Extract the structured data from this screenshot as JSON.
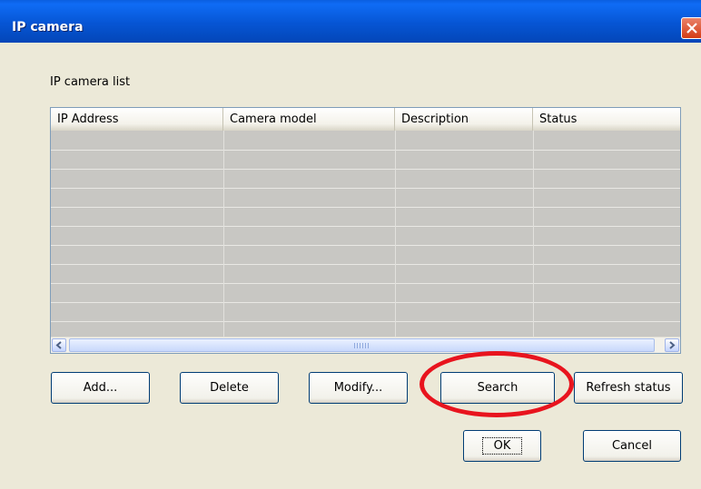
{
  "window": {
    "title": "IP camera"
  },
  "list": {
    "label": "IP camera list",
    "columns": [
      "IP Address",
      "Camera model",
      "Description",
      "Status"
    ],
    "rows": [],
    "scroll_grip": "|||"
  },
  "buttons": {
    "add": "Add...",
    "delete": "Delete",
    "modify": "Modify...",
    "search": "Search",
    "refresh_status": "Refresh status",
    "ok": "OK",
    "cancel": "Cancel"
  },
  "colors": {
    "titlebar": "#0655d4",
    "dialog_background": "#ece9d8",
    "empty_row": "#c8c7c3",
    "highlight_circle": "#e8141e"
  },
  "icons": {
    "close": "close-icon",
    "scroll_left": "chevron-left-icon",
    "scroll_right": "chevron-right-icon"
  }
}
